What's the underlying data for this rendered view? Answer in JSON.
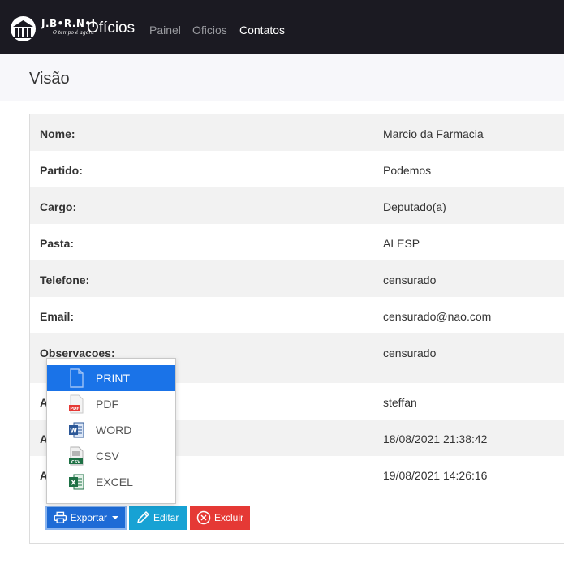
{
  "navbar": {
    "logo_text": "J.B•R.N•I",
    "logo_tagline": "O tempo é agora",
    "brand": "Ofícios",
    "links": [
      {
        "label": "Painel"
      },
      {
        "label": "Oficios"
      },
      {
        "label": "Contatos"
      }
    ],
    "active_link": "Contatos"
  },
  "page": {
    "title": "Visão"
  },
  "details": {
    "rows": [
      {
        "label": "Nome:",
        "value": "Marcio da Farmacia"
      },
      {
        "label": "Partido:",
        "value": "Podemos"
      },
      {
        "label": "Cargo:",
        "value": "Deputado(a)"
      },
      {
        "label": "Pasta:",
        "value": "ALESP"
      },
      {
        "label": "Telefone:",
        "value": "censurado"
      },
      {
        "label": "Email:",
        "value": "censurado@nao.com"
      },
      {
        "label": "Observacoes:",
        "value": "censurado"
      },
      {
        "label": "A",
        "value": "steffan"
      },
      {
        "label": "A",
        "value": "18/08/2021 21:38:42"
      },
      {
        "label": "A",
        "value": "19/08/2021 14:26:16"
      }
    ]
  },
  "actions": {
    "export_label": "Exportar",
    "edit_label": "Editar",
    "delete_label": "Excluir"
  },
  "export_menu": {
    "items": [
      {
        "label": "PRINT",
        "icon": "print-file-icon"
      },
      {
        "label": "PDF",
        "icon": "pdf-file-icon"
      },
      {
        "label": "WORD",
        "icon": "word-file-icon"
      },
      {
        "label": "CSV",
        "icon": "csv-file-icon"
      },
      {
        "label": "EXCEL",
        "icon": "excel-file-icon"
      }
    ],
    "active_item": "PRINT"
  },
  "colors": {
    "navbar_bg": "#1b1a22",
    "export_button": "#1e6bd6",
    "edit_button": "#17a2d4",
    "delete_button": "#e53935",
    "menu_active": "#1a73e8"
  }
}
